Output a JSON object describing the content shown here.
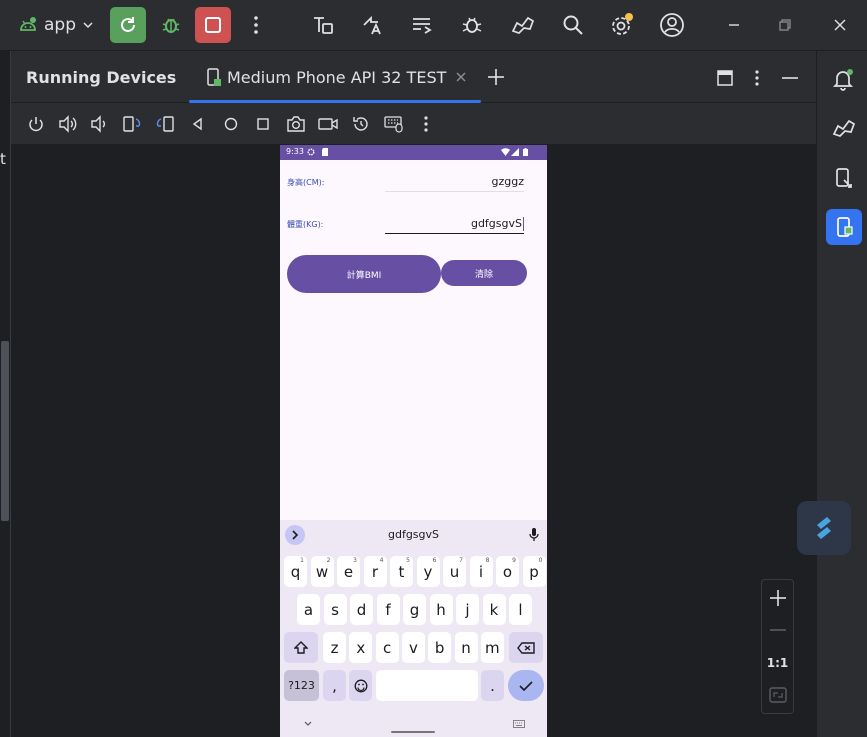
{
  "toolbar": {
    "run_config": "app"
  },
  "panel": {
    "title": "Running Devices",
    "device_tab": "Medium Phone API 32 TEST"
  },
  "zoom": {
    "fit_label": "1:1"
  },
  "left_edge_text": "t",
  "phone": {
    "status_time": "9:33",
    "height_label": "身高(CM):",
    "height_value": "gzggz",
    "weight_label": "體重(KG):",
    "weight_value": "gdfgsgvS",
    "calc_button": "計算BMI",
    "clear_button": "清除"
  },
  "keyboard": {
    "suggestion": "gdfgsgvS",
    "row1": [
      "q",
      "w",
      "e",
      "r",
      "t",
      "y",
      "u",
      "i",
      "o",
      "p"
    ],
    "row1_hints": [
      "1",
      "2",
      "3",
      "4",
      "5",
      "6",
      "7",
      "8",
      "9",
      "0"
    ],
    "row2": [
      "a",
      "s",
      "d",
      "f",
      "g",
      "h",
      "j",
      "k",
      "l"
    ],
    "row3": [
      "z",
      "x",
      "c",
      "v",
      "b",
      "n",
      "m"
    ],
    "symbols_key": "?123",
    "comma_key": ",",
    "period_key": "."
  },
  "colors": {
    "accent": "#3574f0",
    "run_green": "#58a05c",
    "stop_red": "#cf5252",
    "phone_primary": "#6750a4"
  }
}
